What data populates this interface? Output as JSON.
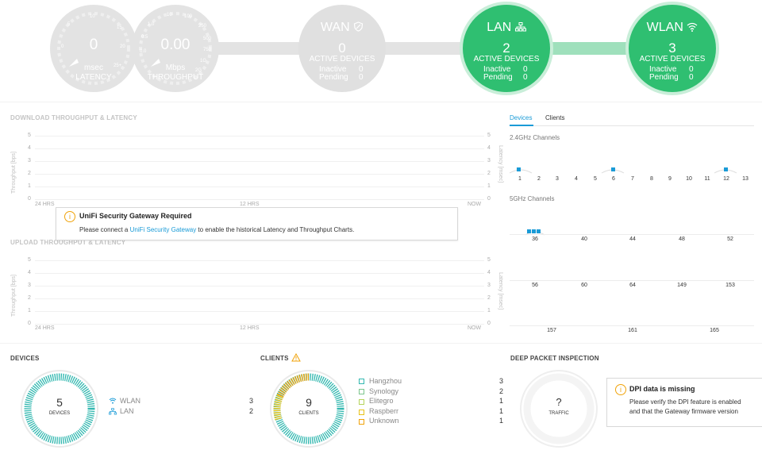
{
  "top": {
    "latency": {
      "value": "0",
      "unit": "msec",
      "caption": "LATENCY",
      "ticks": [
        "0",
        "10",
        "15",
        "20",
        "25+",
        "5"
      ]
    },
    "throughput": {
      "value": "0.00",
      "unit": "Mbps",
      "caption": "THROUGHPUT",
      "ticks": [
        "1.0",
        "10",
        "100",
        "250",
        "500",
        "750",
        "1G",
        "0.0",
        "0.5",
        "250",
        "2G"
      ]
    },
    "wan": {
      "title": "WAN",
      "count": "0",
      "sub": "ACTIVE DEVICES",
      "inactive_label": "Inactive",
      "inactive": "0",
      "pending_label": "Pending",
      "pending": "0"
    },
    "lan": {
      "title": "LAN",
      "count": "2",
      "sub": "ACTIVE DEVICES",
      "inactive_label": "Inactive",
      "inactive": "0",
      "pending_label": "Pending",
      "pending": "0"
    },
    "wlan": {
      "title": "WLAN",
      "count": "3",
      "sub": "ACTIVE DEVICES",
      "inactive_label": "Inactive",
      "inactive": "0",
      "pending_label": "Pending",
      "pending": "0"
    }
  },
  "download_chart": {
    "title": "DOWNLOAD THROUGHPUT & LATENCY",
    "ylabel": "Throughput [bps]",
    "ylabel_right": "Latency [msec]",
    "yticks": [
      "5",
      "4",
      "3",
      "2",
      "1",
      "0"
    ],
    "xticks": [
      "24 HRS",
      "12 HRS",
      "NOW"
    ]
  },
  "upload_chart": {
    "title": "UPLOAD THROUGHPUT & LATENCY",
    "ylabel": "Throughput [bps]",
    "ylabel_right": "Latency [msec]",
    "yticks": [
      "5",
      "4",
      "3",
      "2",
      "1",
      "0"
    ],
    "xticks": [
      "24 HRS",
      "12 HRS",
      "NOW"
    ]
  },
  "gateway_warning": {
    "title": "UniFi Security Gateway Required",
    "text_before": "Please connect a ",
    "link": "UniFi Security Gateway",
    "text_after": " to enable the historical Latency and Throughput Charts."
  },
  "channels": {
    "tabs": [
      "Devices",
      "Clients"
    ],
    "band24_label": "2.4GHz Channels",
    "band24": [
      "1",
      "2",
      "3",
      "4",
      "5",
      "6",
      "7",
      "8",
      "9",
      "10",
      "11",
      "12",
      "13"
    ],
    "band5_label": "5GHz Channels",
    "band5_row1": [
      "36",
      "40",
      "44",
      "48",
      "52"
    ],
    "band5_row2": [
      "56",
      "60",
      "64",
      "149",
      "153"
    ],
    "band5_row3": [
      "157",
      "161",
      "165"
    ]
  },
  "devices": {
    "title": "DEVICES",
    "total": "5",
    "caption": "DEVICES",
    "items": [
      {
        "label": "WLAN",
        "count": "3"
      },
      {
        "label": "LAN",
        "count": "2"
      }
    ]
  },
  "clients": {
    "title": "CLIENTS",
    "total": "9",
    "caption": "CLIENTS",
    "items": [
      {
        "label": "Hangzhou",
        "count": "3"
      },
      {
        "label": "Synology",
        "count": "2"
      },
      {
        "label": "Elitegro",
        "count": "1"
      },
      {
        "label": "Raspberr",
        "count": "1"
      },
      {
        "label": "Unknown",
        "count": "1"
      }
    ]
  },
  "dpi": {
    "title": "DEEP PACKET INSPECTION",
    "value": "?",
    "caption": "TRAFFIC",
    "warn_title": "DPI data is missing",
    "warn_text1": "Please verify the DPI feature is enabled",
    "warn_text2": "and that the Gateway firmware version"
  },
  "colors": {
    "green": "#2fbf71",
    "grey": "#e3e3e3",
    "blue": "#1a9bd7",
    "orange": "#f0a30a",
    "teal": "#33b8b0"
  }
}
